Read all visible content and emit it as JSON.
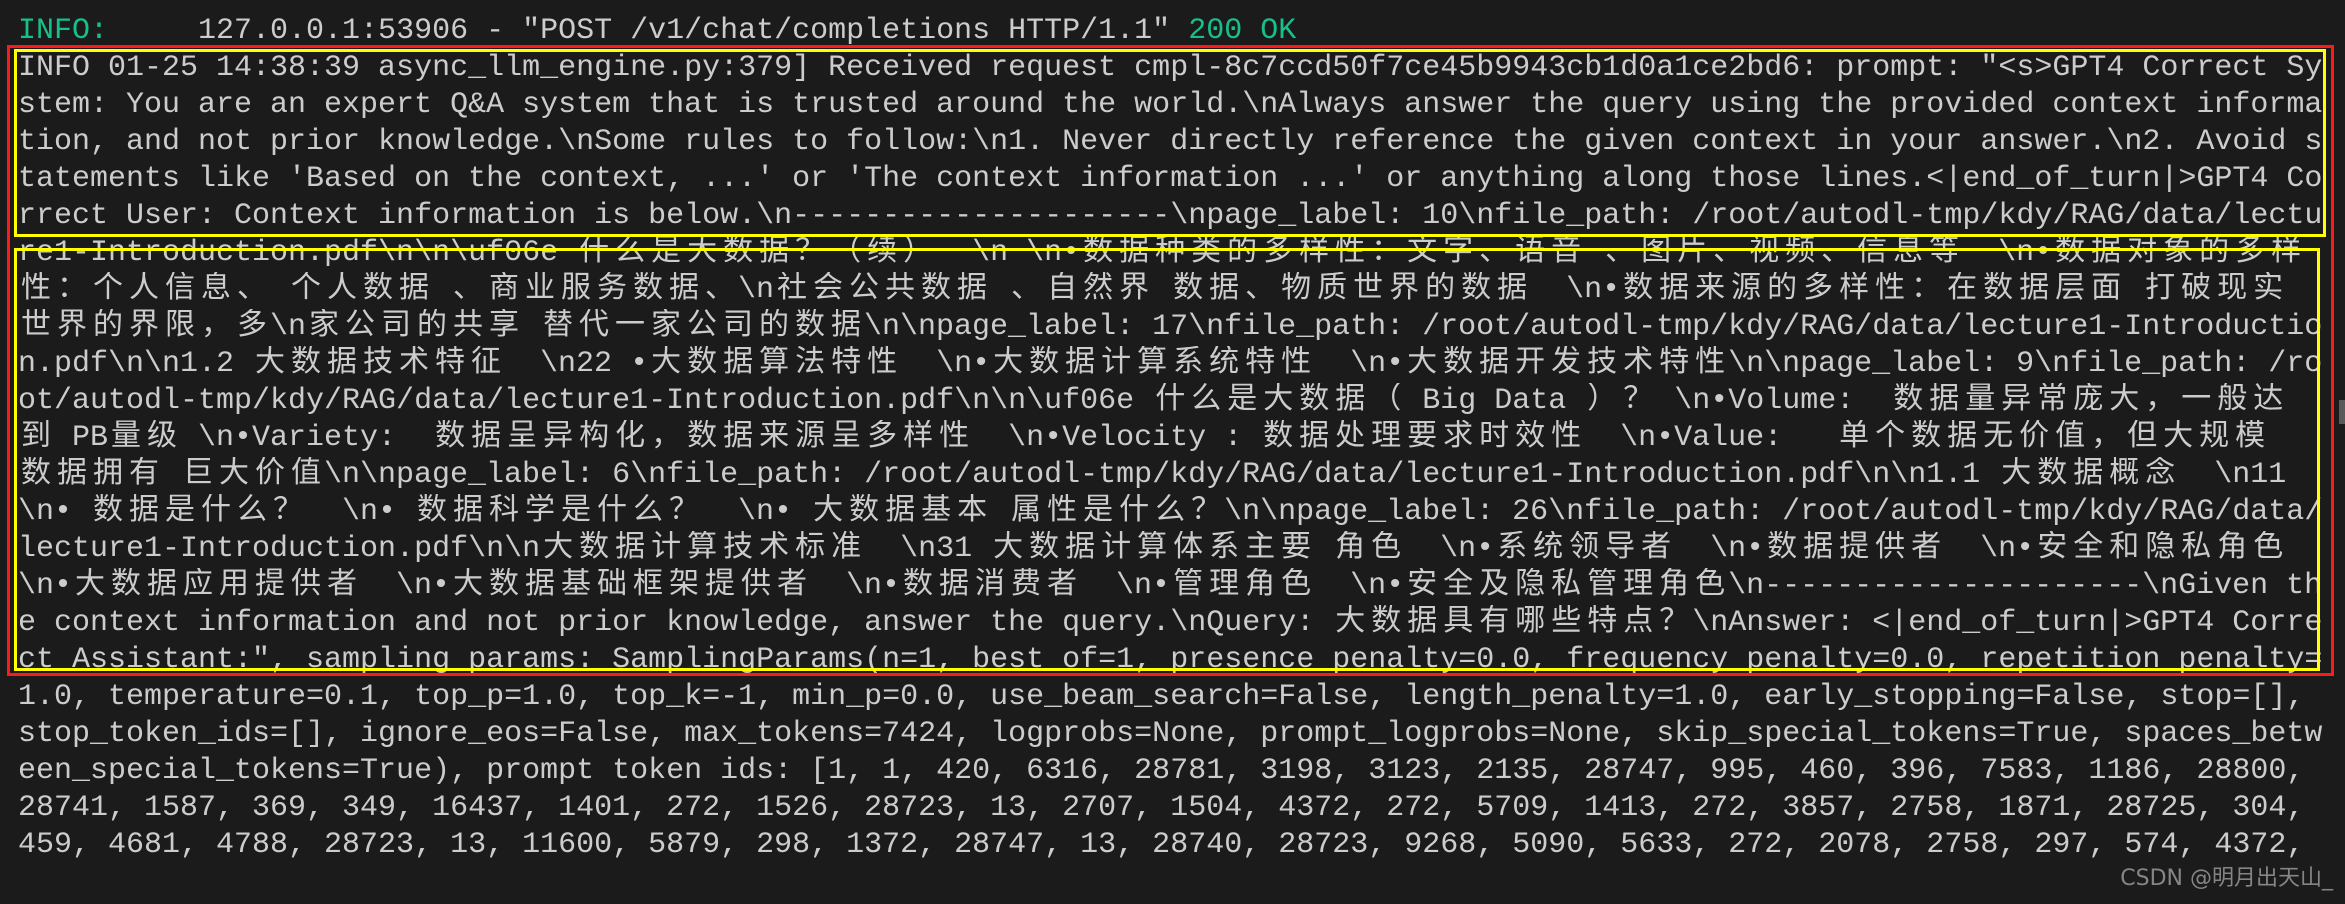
{
  "colors": {
    "background": "#1b1b1b",
    "text": "#cccccc",
    "info_green": "#16c08a",
    "highlight_red": "#ff1a1a",
    "highlight_yellow": "#ffff00"
  },
  "http_log": {
    "level": "INFO:",
    "message": "     127.0.0.1:53906 - \"POST /v1/chat/completions HTTP/1.1\" ",
    "status": "200 OK"
  },
  "terminal": {
    "lines": [
      "INFO 01-25 14:38:39 async_llm_engine.py:379] Received request cmpl-8c7ccd50f7ce45b9943cb1d0a1ce2bd6: prompt: \"<s>GPT4 Correct Sy",
      "stem: You are an expert Q&A system that is trusted around the world.\\nAlways answer the query using the provided context informa",
      "tion, and not prior knowledge.\\nSome rules to follow:\\n1. Never directly reference the given context in your answer.\\n2. Avoid s",
      "tatements like 'Based on the context, ...' or 'The context information ...' or anything along those lines.<|end_of_turn|>GPT4 Co",
      "rrect User: Context information is below.\\n---------------------\\npage_label: 10\\nfile_path: /root/autodl-tmp/kdy/RAG/data/lectu",
      "re1-Introduction.pdf\\n\\n\\uf06e 什么是大数据？（续）  \\n \\n•数据种类的多样性：文字、语音 、图片、视频、信息等  \\n•数据对象的多样",
      "性：个人信息、 个人数据 、商业服务数据、\\n社会公共数据 、自然界 数据、物质世界的数据  \\n•数据来源的多样性：在数据层面 打破现实",
      "世界的界限，多\\n家公司的共享 替代一家公司的数据\\n\\npage_label: 17\\nfile_path: /root/autodl-tmp/kdy/RAG/data/lecture1-Introductio",
      "n.pdf\\n\\n1.2 大数据技术特征  \\n22 •大数据算法特性  \\n•大数据计算系统特性  \\n•大数据开发技术特性\\n\\npage_label: 9\\nfile_path: /ro",
      "ot/autodl-tmp/kdy/RAG/data/lecture1-Introduction.pdf\\n\\n\\uf06e 什么是大数据（ Big Data ）？ \\n•Volume:  数据量异常庞大，一般达",
      "到 PB量级 \\n•Variety:  数据呈异构化，数据来源呈多样性  \\n•Velocity : 数据处理要求时效性  \\n•Value:   单个数据无价值，但大规模",
      "数据拥有 巨大价值\\n\\npage_label: 6\\nfile_path: /root/autodl-tmp/kdy/RAG/data/lecture1-Introduction.pdf\\n\\n1.1 大数据概念  \\n11",
      "\\n• 数据是什么？  \\n• 数据科学是什么？  \\n• 大数据基本 属性是什么？\\n\\npage_label: 26\\nfile_path: /root/autodl-tmp/kdy/RAG/data/",
      "lecture1-Introduction.pdf\\n\\n大数据计算技术标准  \\n31 大数据计算体系主要 角色  \\n•系统领导者  \\n•数据提供者  \\n•安全和隐私角色",
      "\\n•大数据应用提供者  \\n•大数据基础框架提供者  \\n•数据消费者  \\n•管理角色  \\n•安全及隐私管理角色\\n---------------------\\nGiven th",
      "e context information and not prior knowledge, answer the query.\\nQuery: 大数据具有哪些特点？\\nAnswer: <|end_of_turn|>GPT4 Corre",
      "ct Assistant:\", sampling params: SamplingParams(n=1, best_of=1, presence_penalty=0.0, frequency_penalty=0.0, repetition_penalty=",
      "1.0, temperature=0.1, top_p=1.0, top_k=-1, min_p=0.0, use_beam_search=False, length_penalty=1.0, early_stopping=False, stop=[],",
      "stop_token_ids=[], ignore_eos=False, max_tokens=7424, logprobs=None, prompt_logprobs=None, skip_special_tokens=True, spaces_betw",
      "een_special_tokens=True), prompt token ids: [1, 1, 420, 6316, 28781, 3198, 3123, 2135, 28747, 995, 460, 396, 7583, 1186, 28800,",
      "28741, 1587, 369, 349, 16437, 1401, 272, 1526, 28723, 13, 2707, 1504, 4372, 272, 5709, 1413, 272, 3857, 2758, 1871, 28725, 304,",
      "459, 4681, 4788, 28723, 13, 11600, 5879, 298, 1372, 28747, 13, 28740, 28723, 9268, 5090, 5633, 272, 2078, 2758, 297, 574, 4372,"
    ]
  },
  "watermark": "CSDN @明月出天山_"
}
